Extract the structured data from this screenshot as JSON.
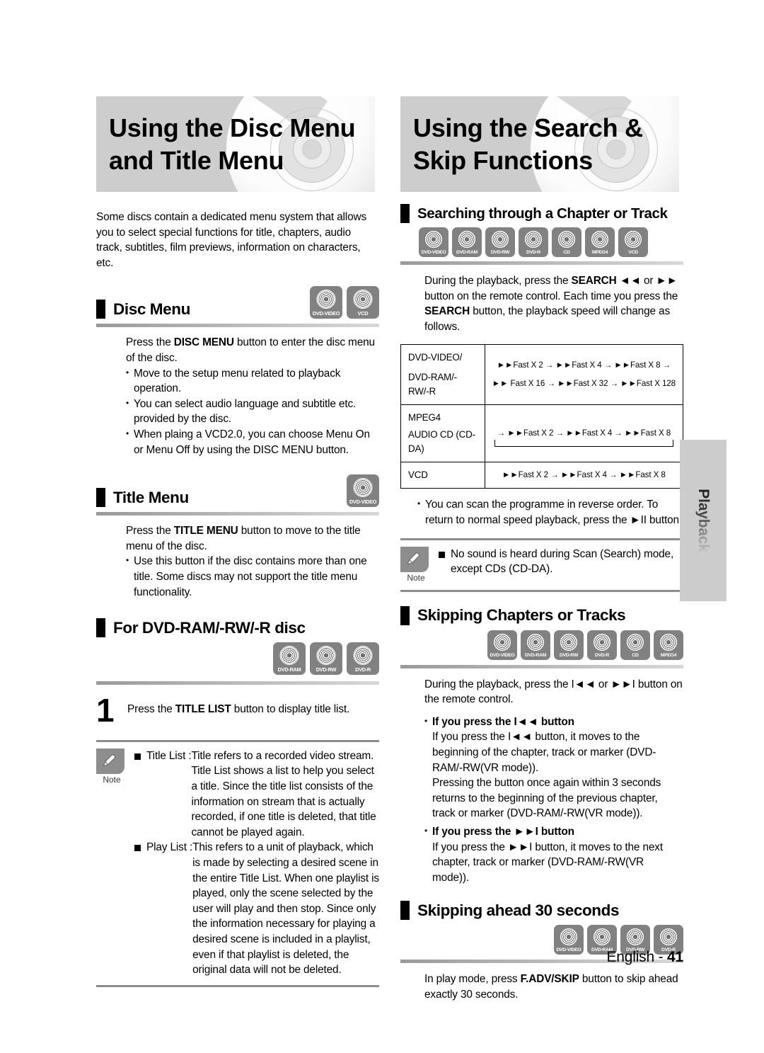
{
  "banners": {
    "left": "Using the Disc Menu and Title Menu",
    "right": "Using the Search & Skip Functions"
  },
  "left_column": {
    "intro": "Some discs contain a dedicated menu system that allows you to select special functions for title, chapters, audio track, subtitles, film previews, information on characters, etc.",
    "disc_menu": {
      "heading": "Disc Menu",
      "badges": [
        "DVD-VIDEO",
        "VCD"
      ],
      "lead_pre": "Press the ",
      "lead_bold": "DISC MENU",
      "lead_post": " button to enter the disc menu of the disc.",
      "bullets": [
        "Move to the setup menu related to playback operation.",
        "You can select audio language and subtitle etc. provided by the disc.",
        "When plaing a VCD2.0, you can choose Menu On or Menu Off by using the DISC MENU button."
      ]
    },
    "title_menu": {
      "heading": "Title Menu",
      "badges": [
        "DVD-VIDEO"
      ],
      "lead_pre": "Press the ",
      "lead_bold": "TITLE MENU",
      "lead_post": " button to move to the title menu of the disc.",
      "bullets": [
        "Use this button if the disc contains more than one title. Some discs may not support the title menu functionality."
      ]
    },
    "for_dvd": {
      "heading": "For DVD-RAM/-RW/-R disc",
      "badges": [
        "DVD-RAM",
        "DVD-RW",
        "DVD-R"
      ],
      "step_number": "1",
      "step_pre": "Press the ",
      "step_bold": "TITLE LIST",
      "step_post": " button to display title list."
    },
    "note": {
      "label": "Note",
      "items": [
        {
          "term": "Title List : ",
          "def": "Title refers to a recorded video stream. Title List shows a list to help you select a title. Since the title list consists of the information on stream that is actually recorded, if one title is deleted, that title cannot be played again."
        },
        {
          "term": "Play List : ",
          "def": "This refers to a unit of playback, which is made by selecting a desired scene in the entire Title List. When one playlist is played, only the scene selected by the user will play and then stop. Since only the information necessary for playing a desired scene is included in a playlist, even if that playlist is deleted, the original data will not be deleted."
        }
      ]
    }
  },
  "right_column": {
    "searching": {
      "heading": "Searching through a Chapter or Track",
      "badges": [
        "DVD-VIDEO",
        "DVD-RAM",
        "DVD-RW",
        "DVD-R",
        "CD",
        "MPEG4",
        "VCD"
      ],
      "body_1": "During the playback, press the ",
      "body_b1": "SEARCH",
      "body_2": " ◄◄ or ►► button on the remote control. Each time you press the ",
      "body_b2": "SEARCH",
      "body_3": " button, the playback speed will change as follows.",
      "table": [
        {
          "label": "DVD-VIDEO/\nDVD-RAM/-RW/-R",
          "value_line1": "►►Fast X 2 → ►►Fast X 4 → ►►Fast X 8 →",
          "value_line2": "►► Fast X 16 → ►►Fast X 32 → ►►Fast X 128",
          "loop": false
        },
        {
          "label": "MPEG4\nAUDIO CD (CD-DA)",
          "value_line1": "→ ►►Fast X 2 → ►►Fast X 4 → ►►Fast X 8",
          "value_line2": "",
          "loop": true
        },
        {
          "label": "VCD",
          "value_line1": "►►Fast X 2 → ►►Fast X 4 → ►►Fast X 8",
          "value_line2": "",
          "loop": false
        }
      ],
      "bullet": "You can scan the programme in reverse order. To return to normal speed playback, press the ►II button.",
      "note_label": "Note",
      "note_item": "No sound is heard during Scan (Search) mode, except CDs (CD-DA)."
    },
    "skipping": {
      "heading": "Skipping Chapters or Tracks",
      "badges": [
        "DVD-VIDEO",
        "DVD-RAM",
        "DVD-RW",
        "DVD-R",
        "CD",
        "MPEG4"
      ],
      "body": "During the playback, press the I◄◄ or ►►I button on the remote control.",
      "sub_1_head": "If you press the I◄◄ button",
      "sub_1_body": "If you press the I◄◄ button, it moves to the beginning of the chapter, track or marker (DVD-RAM/-RW(VR mode)).\nPressing the button once again within 3 seconds returns to the beginning of the previous chapter, track or marker (DVD-RAM/-RW(VR mode)).",
      "sub_2_head": "If you press the ►►I button",
      "sub_2_body": "If you press the ►►I button, it moves to the next chapter, track or marker (DVD-RAM/-RW(VR mode))."
    },
    "skip30": {
      "heading": "Skipping ahead 30 seconds",
      "badges": [
        "DVD-VIDEO",
        "DVD-RAM",
        "DVD-RW",
        "DVD-R"
      ],
      "body_1": "In play mode, press ",
      "body_b": "F.ADV/SKIP",
      "body_2": " button to skip ahead exactly 30 seconds."
    }
  },
  "side_tab": "Playback",
  "footer": {
    "language": "English - ",
    "page": "41"
  }
}
